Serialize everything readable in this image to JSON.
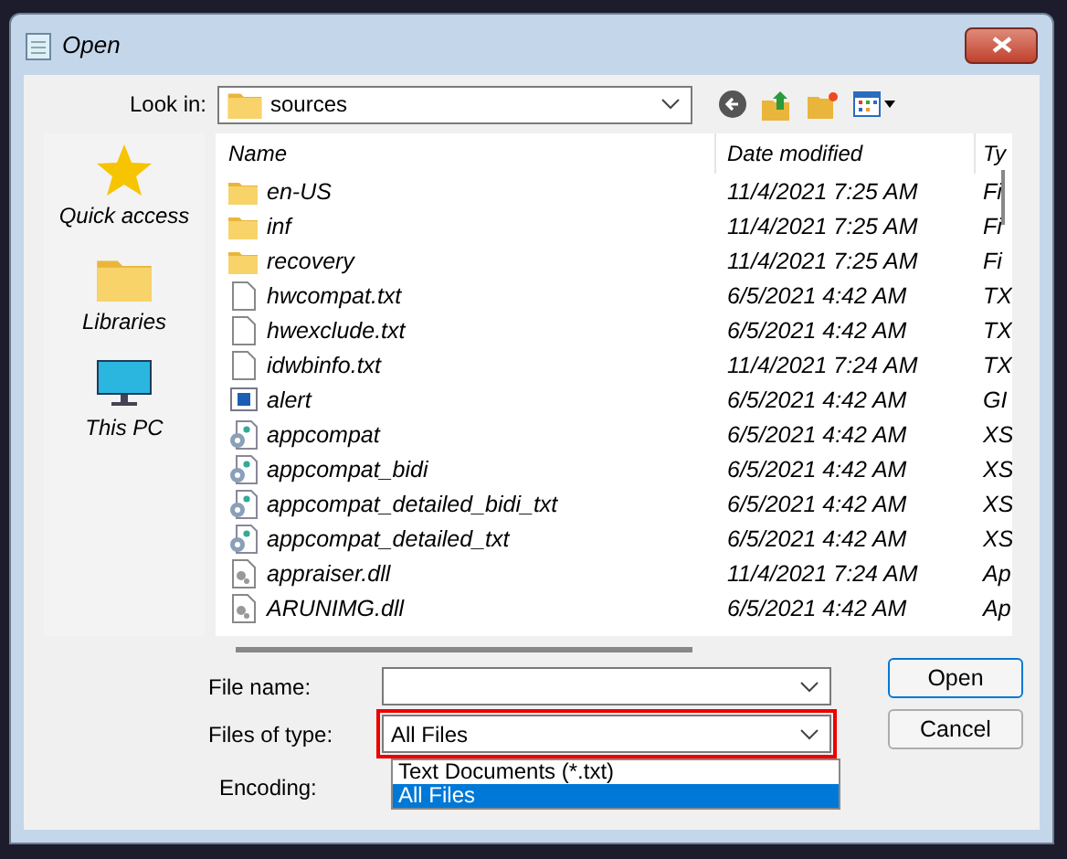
{
  "window": {
    "title": "Open"
  },
  "look_in": {
    "label": "Look in:",
    "value": "sources"
  },
  "places": [
    {
      "label": "Quick access",
      "kind": "star"
    },
    {
      "label": "Libraries",
      "kind": "library"
    },
    {
      "label": "This PC",
      "kind": "pc"
    }
  ],
  "columns": [
    "Name",
    "Date modified",
    "Ty"
  ],
  "files": [
    {
      "name": "en-US",
      "date": "11/4/2021 7:25 AM",
      "type": "Fi",
      "kind": "folder"
    },
    {
      "name": "inf",
      "date": "11/4/2021 7:25 AM",
      "type": "Fi",
      "kind": "folder"
    },
    {
      "name": "recovery",
      "date": "11/4/2021 7:25 AM",
      "type": "Fi",
      "kind": "folder"
    },
    {
      "name": "hwcompat.txt",
      "date": "6/5/2021 4:42 AM",
      "type": "TX",
      "kind": "text"
    },
    {
      "name": "hwexclude.txt",
      "date": "6/5/2021 4:42 AM",
      "type": "TX",
      "kind": "text"
    },
    {
      "name": "idwbinfo.txt",
      "date": "11/4/2021 7:24 AM",
      "type": "TX",
      "kind": "text"
    },
    {
      "name": "alert",
      "date": "6/5/2021 4:42 AM",
      "type": "GI",
      "kind": "image"
    },
    {
      "name": "appcompat",
      "date": "6/5/2021 4:42 AM",
      "type": "XS",
      "kind": "config"
    },
    {
      "name": "appcompat_bidi",
      "date": "6/5/2021 4:42 AM",
      "type": "XS",
      "kind": "config"
    },
    {
      "name": "appcompat_detailed_bidi_txt",
      "date": "6/5/2021 4:42 AM",
      "type": "XS",
      "kind": "config"
    },
    {
      "name": "appcompat_detailed_txt",
      "date": "6/5/2021 4:42 AM",
      "type": "XS",
      "kind": "config"
    },
    {
      "name": "appraiser.dll",
      "date": "11/4/2021 7:24 AM",
      "type": "Ap",
      "kind": "dll"
    },
    {
      "name": "ARUNIMG.dll",
      "date": "6/5/2021 4:42 AM",
      "type": "Ap",
      "kind": "dll"
    }
  ],
  "file_name": {
    "label": "File name:"
  },
  "file_type": {
    "label": "Files of type:",
    "value": "All Files",
    "options": [
      {
        "label": "Text Documents (*.txt)",
        "selected": false
      },
      {
        "label": "All Files",
        "selected": true
      }
    ]
  },
  "encoding": {
    "label": "Encoding:"
  },
  "buttons": [
    "Open",
    "Cancel"
  ]
}
